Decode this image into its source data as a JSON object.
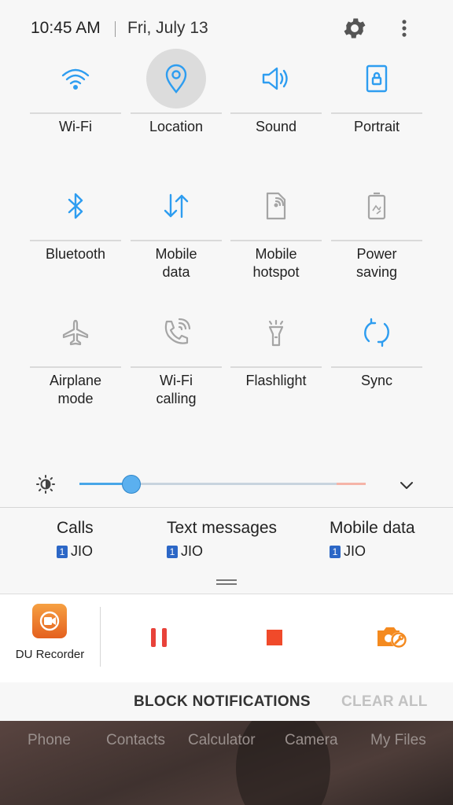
{
  "status": {
    "time": "10:45 AM",
    "date": "Fri, July 13"
  },
  "tiles": [
    {
      "label": "Wi-Fi",
      "icon": "wifi-icon",
      "active": true
    },
    {
      "label": "Location",
      "icon": "location-pin-icon",
      "active": true
    },
    {
      "label": "Sound",
      "icon": "speaker-icon",
      "active": true
    },
    {
      "label": "Portrait",
      "icon": "portrait-lock-icon",
      "active": true
    },
    {
      "label": "Bluetooth",
      "icon": "bluetooth-icon",
      "active": true
    },
    {
      "label": "Mobile\ndata",
      "icon": "mobile-data-icon",
      "active": true
    },
    {
      "label": "Mobile\nhotspot",
      "icon": "hotspot-icon",
      "active": false
    },
    {
      "label": "Power\nsaving",
      "icon": "power-saving-icon",
      "active": false
    },
    {
      "label": "Airplane\nmode",
      "icon": "airplane-icon",
      "active": false
    },
    {
      "label": "Wi-Fi\ncalling",
      "icon": "wifi-calling-icon",
      "active": false
    },
    {
      "label": "Flashlight",
      "icon": "flashlight-icon",
      "active": false
    },
    {
      "label": "Sync",
      "icon": "sync-icon",
      "active": true
    }
  ],
  "brightness": {
    "level": 0.18,
    "icon": "brightness-icon"
  },
  "sim": [
    {
      "title": "Calls",
      "slot": "1",
      "carrier": "JIO"
    },
    {
      "title": "Text messages",
      "slot": "1",
      "carrier": "JIO"
    },
    {
      "title": "Mobile data",
      "slot": "1",
      "carrier": "JIO"
    }
  ],
  "notification": {
    "app_name": "DU Recorder"
  },
  "actions": {
    "block": "BLOCK NOTIFICATIONS",
    "clear": "CLEAR ALL"
  },
  "home_apps": [
    "Phone",
    "Contacts",
    "Calculator",
    "Camera",
    "My Files"
  ],
  "colors": {
    "active_icon": "#2e9df0",
    "inactive_icon": "#9a9a9a",
    "pause": "#e8423a",
    "stop": "#f04a2a",
    "camera": "#f48a1f"
  }
}
